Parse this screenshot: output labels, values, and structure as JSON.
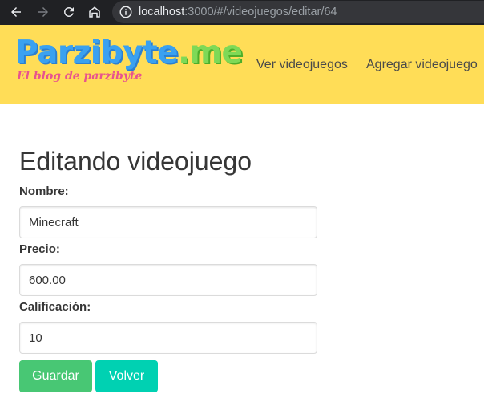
{
  "browser": {
    "url_host": "localhost",
    "url_path": ":3000/#/videojuegos/editar/64",
    "icons": [
      "back-arrow-icon",
      "forward-arrow-icon",
      "reload-icon",
      "home-icon",
      "info-icon"
    ]
  },
  "header": {
    "logo_main": "Parzibyte",
    "logo_suffix": ".me",
    "logo_tagline": "El blog de parzibyte",
    "nav": [
      "Ver videojuegos",
      "Agregar videojuego"
    ],
    "background_color": "#ffdd57"
  },
  "form": {
    "title": "Editando videojuego",
    "fields": [
      {
        "label": "Nombre:",
        "value": "Minecraft"
      },
      {
        "label": "Precio:",
        "value": "600.00"
      },
      {
        "label": "Calificación:",
        "value": "10"
      }
    ],
    "save_label": "Guardar",
    "back_label": "Volver",
    "save_color": "#48c774",
    "back_color": "#00d1b2"
  }
}
